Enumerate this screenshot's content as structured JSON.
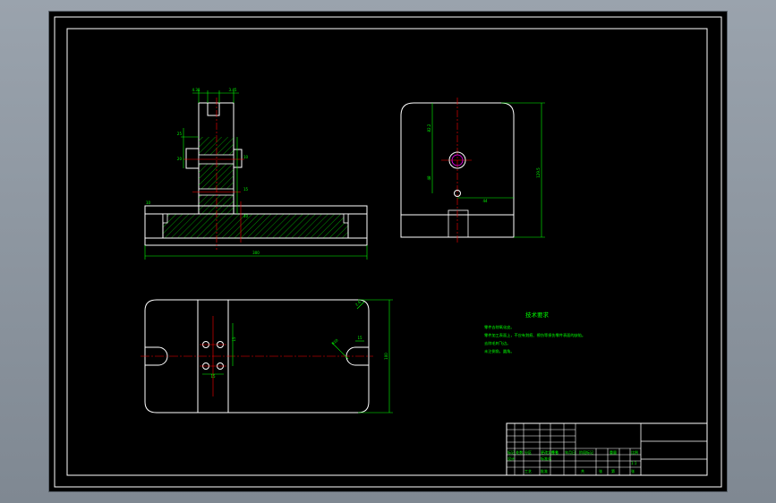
{
  "drawing": {
    "colors": {
      "background": "#000000",
      "outline": "#ffffff",
      "dimension": "#00ff00",
      "centerline": "#ff0000",
      "highlight": "#ff00ff"
    },
    "front_view": {
      "width_dim": "300",
      "top_left_dim": "4.38",
      "top_right_dim": "3.45",
      "small_dims": [
        "25",
        "20",
        "10",
        "15",
        "40"
      ],
      "base_step_dim": "10"
    },
    "side_view": {
      "height_dim": "129.5",
      "hole_dim": "82.2",
      "vertical_dim": "48",
      "horizontal_dim": "44"
    },
    "top_view": {
      "height_dim": "100",
      "radius_dim": "R10",
      "hole_dim": "2.6",
      "spacing_dim": "15",
      "slot_dim": "15"
    },
    "technical_requirements": {
      "title": "技术要求",
      "items": [
        "零件去除氧化皮。",
        "零件加工表面上，不应有划痕、擦伤等损伤零件表面的缺陷。",
        "去除毛刺飞边。",
        "未注倒角，圆角。"
      ]
    },
    "title_block": {
      "row_labels": [
        "标记 处数",
        "分区",
        "更改文件号",
        "签名",
        "年月日"
      ],
      "design_label": "设计",
      "standard_label": "标准化",
      "process_label": "工艺",
      "approve_label": "批准",
      "stage_label": "阶段标记",
      "weight_label": "重量",
      "scale_label": "比例",
      "scale_value": "1:1",
      "sheet_labels": [
        "共",
        "张",
        "第",
        "张"
      ]
    }
  }
}
